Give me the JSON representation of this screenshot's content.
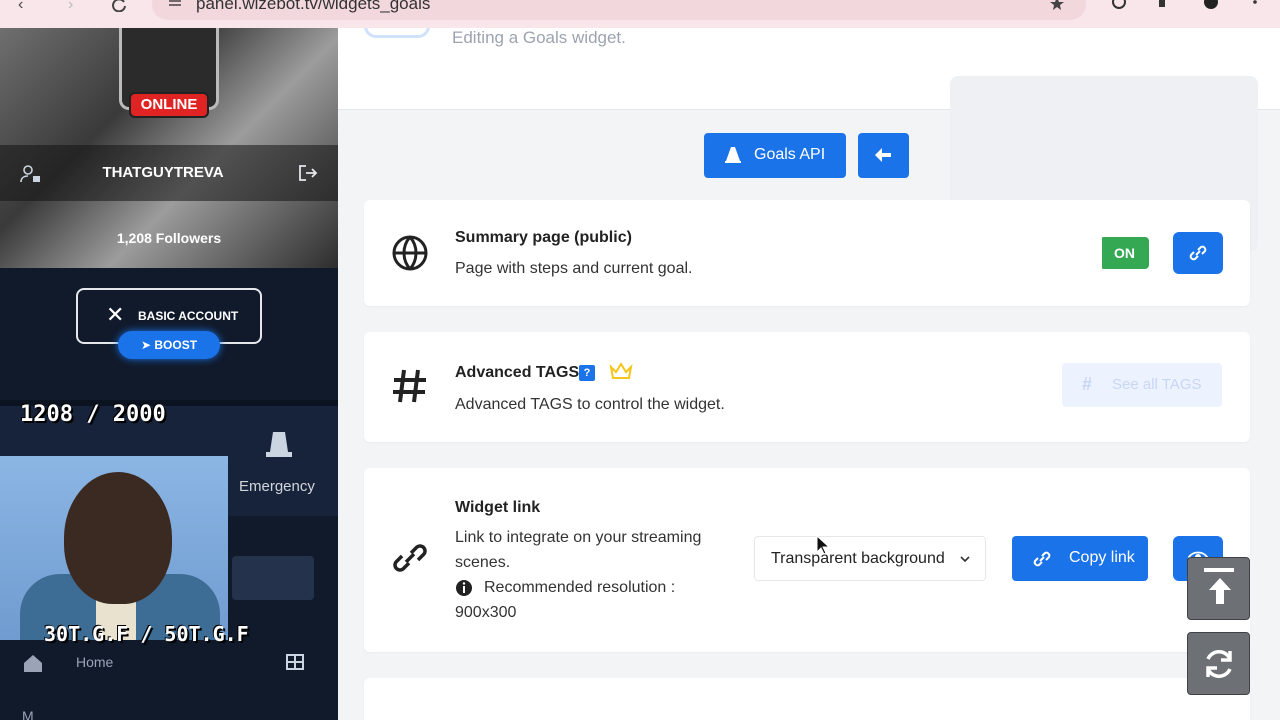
{
  "browser": {
    "url": "panel.wizebot.tv/widgets_goals"
  },
  "sidebar": {
    "status_badge": "ONLINE",
    "username": "THATGUYTREVA",
    "followers": "1,208 Followers",
    "account_label": "BASIC ACCOUNT",
    "boost_label": "BOOST",
    "emergency_label": "Emergency",
    "home_label": "Home",
    "bottom_label": "M"
  },
  "stream_overlay": {
    "follower_count": "1208 / 2000",
    "goal_text": "30T.G.F / 50T.G.F"
  },
  "header": {
    "subtitle": "Editing a Goals widget."
  },
  "actions": {
    "api_label": "Goals API"
  },
  "cards": {
    "summary": {
      "title": "Summary page (public)",
      "desc": "Page with steps and current goal.",
      "toggle_label": "ON"
    },
    "tags": {
      "title": "Advanced TAGS",
      "badge": "?",
      "desc": "Advanced TAGS to control the widget.",
      "button_label": "See all TAGS"
    },
    "widget_link": {
      "title": "Widget link",
      "desc": "Link to integrate on your streaming scenes.",
      "resolution": "Recommended resolution : 900x300",
      "background_select": "Transparent background",
      "copy_label": "Copy link"
    }
  },
  "colors": {
    "primary": "#1a73e8",
    "toggle_on": "#34a853",
    "online": "#e02424"
  }
}
